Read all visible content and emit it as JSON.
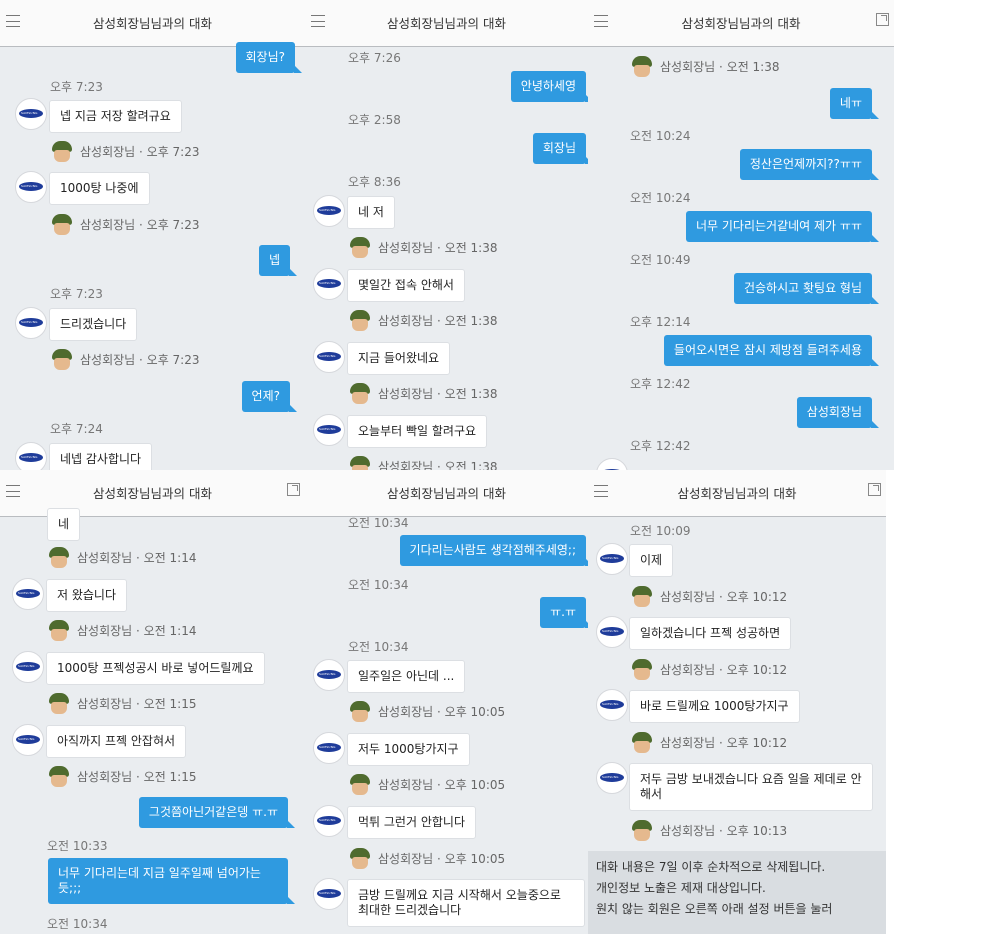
{
  "panels": [
    {
      "title": "삼성회장님님과의 대화",
      "messages": [
        {
          "kind": "me",
          "text": "회장님?"
        },
        {
          "kind": "ts",
          "text": "오후 7:23"
        },
        {
          "kind": "them",
          "text": "넵 지금 저장 할려규요"
        },
        {
          "kind": "nick",
          "name": "삼성회장님",
          "time": "오후 7:23"
        },
        {
          "kind": "them",
          "text": "1000탕 나중에"
        },
        {
          "kind": "nick",
          "name": "삼성회장님",
          "time": "오후 7:23"
        },
        {
          "kind": "me",
          "text": "넵"
        },
        {
          "kind": "ts",
          "text": "오후 7:23"
        },
        {
          "kind": "them",
          "text": "드리겠습니다"
        },
        {
          "kind": "nick",
          "name": "삼성회장님",
          "time": "오후 7:23"
        },
        {
          "kind": "me",
          "text": "언제?"
        },
        {
          "kind": "ts",
          "text": "오후 7:24"
        },
        {
          "kind": "them",
          "text": "네넵 감사합니다"
        }
      ]
    },
    {
      "title": "삼성회장님님과의 대화",
      "messages": [
        {
          "kind": "ts",
          "text": "오후 7:26"
        },
        {
          "kind": "me",
          "text": "안녕하세영"
        },
        {
          "kind": "ts",
          "text": "오후 2:58"
        },
        {
          "kind": "me",
          "text": "회장님"
        },
        {
          "kind": "ts",
          "text": "오후 8:36"
        },
        {
          "kind": "them",
          "text": "네 저"
        },
        {
          "kind": "nick",
          "name": "삼성회장님",
          "time": "오전 1:38"
        },
        {
          "kind": "them",
          "text": "몇일간 접속 안해서"
        },
        {
          "kind": "nick",
          "name": "삼성회장님",
          "time": "오전 1:38"
        },
        {
          "kind": "them",
          "text": "지금 들어왔네요"
        },
        {
          "kind": "nick",
          "name": "삼성회장님",
          "time": "오전 1:38"
        },
        {
          "kind": "them",
          "text": "오늘부터 빡일 할려구요"
        },
        {
          "kind": "nick",
          "name": "삼성회장님",
          "time": "오전 1:38"
        }
      ]
    },
    {
      "title": "삼성회장님님과의 대화",
      "messages": [
        {
          "kind": "nick",
          "name": "삼성회장님",
          "time": "오전 1:38"
        },
        {
          "kind": "me",
          "text": "네ㅠ"
        },
        {
          "kind": "ts",
          "text": "오전 10:24"
        },
        {
          "kind": "me",
          "text": "정산은언제까지??ㅠㅠ"
        },
        {
          "kind": "ts",
          "text": "오전 10:24"
        },
        {
          "kind": "me",
          "text": "너무 기다리는거같네여 제가 ㅠㅠ"
        },
        {
          "kind": "ts",
          "text": "오전 10:49"
        },
        {
          "kind": "me",
          "text": "건승하시고 홧팅요 형님"
        },
        {
          "kind": "ts",
          "text": "오후 12:14"
        },
        {
          "kind": "me",
          "text": "들어오시면은 잠시 제방점 들려주세용"
        },
        {
          "kind": "ts",
          "text": "오후 12:42"
        },
        {
          "kind": "me",
          "text": "삼성회장님"
        },
        {
          "kind": "ts",
          "text": "오후 12:42"
        }
      ]
    },
    {
      "title": "삼성회장님님과의 대화",
      "messages": [
        {
          "kind": "them",
          "text": "네"
        },
        {
          "kind": "nick",
          "name": "삼성회장님",
          "time": "오전 1:14"
        },
        {
          "kind": "them",
          "text": "저 왔습니다"
        },
        {
          "kind": "nick",
          "name": "삼성회장님",
          "time": "오전 1:14"
        },
        {
          "kind": "them",
          "text": "1000탕 프젝성공시 바로 넣어드릴께요"
        },
        {
          "kind": "nick",
          "name": "삼성회장님",
          "time": "오전 1:15"
        },
        {
          "kind": "them",
          "text": "아직까지 프젝 안잡혀서"
        },
        {
          "kind": "nick",
          "name": "삼성회장님",
          "time": "오전 1:15"
        },
        {
          "kind": "me",
          "text": "그것쯤아닌거같은뎅 ㅠ.ㅠ"
        },
        {
          "kind": "ts",
          "text": "오전 10:33"
        },
        {
          "kind": "me",
          "text": "너무 기다리는데 지금 일주일째 넘어가는듯;;;"
        },
        {
          "kind": "ts",
          "text": "오전 10:34"
        }
      ]
    },
    {
      "title": "삼성회장님님과의 대화",
      "messages": [
        {
          "kind": "ts",
          "text": "오전 10:34"
        },
        {
          "kind": "me",
          "text": "기다리는사람도 생각점해주세영;;"
        },
        {
          "kind": "ts",
          "text": "오전 10:34"
        },
        {
          "kind": "me",
          "text": "ㅠ.ㅠ"
        },
        {
          "kind": "ts",
          "text": "오전 10:34"
        },
        {
          "kind": "them",
          "text": "일주일은 아닌데 ..."
        },
        {
          "kind": "nick",
          "name": "삼성회장님",
          "time": "오후 10:05"
        },
        {
          "kind": "them",
          "text": "저두 1000탕가지구"
        },
        {
          "kind": "nick",
          "name": "삼성회장님",
          "time": "오후 10:05"
        },
        {
          "kind": "them",
          "text": "먹튀 그런거 안합니다"
        },
        {
          "kind": "nick",
          "name": "삼성회장님",
          "time": "오후 10:05"
        },
        {
          "kind": "them",
          "text": "금방 드릴께요 지금 시작해서 오늘중으로 최대한 드리겠습니다"
        }
      ]
    },
    {
      "title": "삼성회장님님과의 대화",
      "messages": [
        {
          "kind": "ts",
          "text": "오전 10:09"
        },
        {
          "kind": "them",
          "text": "이제"
        },
        {
          "kind": "nick",
          "name": "삼성회장님",
          "time": "오후 10:12"
        },
        {
          "kind": "them",
          "text": "일하겠습니다 프젝 성공하면"
        },
        {
          "kind": "nick",
          "name": "삼성회장님",
          "time": "오후 10:12"
        },
        {
          "kind": "them",
          "text": "바로 드릴께요 1000탕가지구"
        },
        {
          "kind": "nick",
          "name": "삼성회장님",
          "time": "오후 10:12"
        },
        {
          "kind": "them",
          "text": "저두 금방 보내겠습니다 요즘 일을 제데로 안해서"
        },
        {
          "kind": "nick",
          "name": "삼성회장님",
          "time": "오후 10:13"
        }
      ],
      "notice": [
        "대화 내용은 7일 이후 순차적으로 삭제됩니다.",
        "개인정보 노출은 제재 대상입니다.",
        "원치 않는 회원은 오른쪽 아래 설정 버튼을 눌러"
      ]
    }
  ]
}
